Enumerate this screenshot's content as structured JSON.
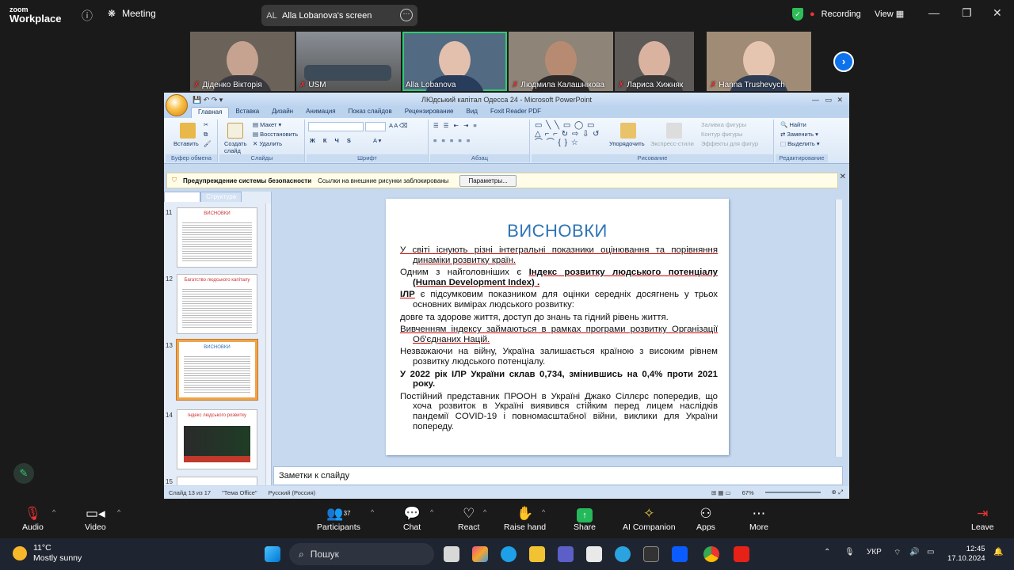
{
  "zoom": {
    "logo_line1": "zoom",
    "logo_line2": "Workplace",
    "meeting_label": "Meeting",
    "screen_avatar": "AL",
    "screen_label": "Alla Lobanova's screen",
    "recording_label": "Recording",
    "view_label": "View"
  },
  "participants": [
    {
      "name": "Діденко Вікторія",
      "muted": true
    },
    {
      "name": "USM",
      "muted": true
    },
    {
      "name": "Alla Lobanova",
      "muted": false,
      "active": true
    },
    {
      "name": "Людмила Калашнікова",
      "muted": true
    },
    {
      "name": "Лариса Хижняк",
      "muted": true
    },
    {
      "name": "Hanna Trushevych",
      "muted": true
    }
  ],
  "ppt": {
    "window_title": "ЛЮдський капітал Одесса 24 - Microsoft PowerPoint",
    "tabs": [
      "Главная",
      "Вставка",
      "Дизайн",
      "Анимация",
      "Показ слайдов",
      "Рецензирование",
      "Вид",
      "Foxit Reader PDF"
    ],
    "ribbon": {
      "paste": "Вставить",
      "new_slide": "Создать слайд",
      "layout": "Макет",
      "reset": "Восстановить",
      "delete": "Удалить",
      "arrange": "Упорядочить",
      "quick_styles": "Экспресс-стили",
      "shape_fill": "Заливка фигуры",
      "shape_outline": "Контур фигуры",
      "shape_effects": "Эффекты для фигур",
      "find": "Найти",
      "replace": "Заменить",
      "select": "Выделить",
      "groups": [
        "Буфер обмена",
        "Слайды",
        "Шрифт",
        "Абзац",
        "Рисование",
        "Редактирование"
      ]
    },
    "security": {
      "title": "Предупреждение системы безопасности",
      "message": "Ссылки на внешние рисунки заблокированы",
      "button": "Параметры..."
    },
    "pane_tabs": [
      "Слайды",
      "Структура"
    ],
    "thumbs": [
      {
        "num": "11",
        "title": "ВИСНОВКИ"
      },
      {
        "num": "12",
        "title": "Багатство людського капіталу"
      },
      {
        "num": "13",
        "title": "ВИСНОВКИ"
      },
      {
        "num": "14",
        "title": "Індекс людського розвитку"
      },
      {
        "num": "15",
        "title": ""
      }
    ],
    "slide": {
      "title": "ВИСНОВКИ",
      "p1": "У світі існують різні інтегральні показники оцінювання та порівняння динаміки розвитку країн.",
      "p2a": "Одним з найголовніших є ",
      "p2b": "Індекс розвитку людського потенціалу (Human Development Index) .",
      "p3a": "ІЛР",
      "p3b": " є підсумковим показником для оцінки середніх досягнень у трьох основних вимірах людського розвитку:",
      "p4": "довге та здорове життя, доступ до знань та гідний рівень життя.",
      "p5": "Вивченням індексу займаються в рамках програми розвитку Організації Об'єднаних Націй.",
      "p6": "Незважаючи на війну, Україна залишається країною з високим рівнем розвитку людського потенціалу.",
      "p7": "У 2022 рік ІЛР України склав 0,734, змінившись на 0,4% проти 2021 року.",
      "p8": "Постійний представник ПРООН в Україні Джако Сіллєрс попередив, що хоча розвиток в Україні виявився стійким перед лицем наслідків пандемії COVID-19 і повномасштабної війни, виклики для України попереду."
    },
    "notes": "Заметки к слайду",
    "status": {
      "slide": "Слайд 13 из 17",
      "theme": "\"Тема Office\"",
      "lang": "Русский (Россия)",
      "zoom": "67%"
    }
  },
  "controls": [
    {
      "label": "Audio",
      "icon": "mic-muted-icon"
    },
    {
      "label": "Video",
      "icon": "video-icon"
    },
    {
      "label": "Participants",
      "icon": "participants-icon",
      "count": "37"
    },
    {
      "label": "Chat",
      "icon": "chat-icon"
    },
    {
      "label": "React",
      "icon": "heart-icon"
    },
    {
      "label": "Raise hand",
      "icon": "hand-icon"
    },
    {
      "label": "Share",
      "icon": "share-icon"
    },
    {
      "label": "AI Companion",
      "icon": "sparkle-icon"
    },
    {
      "label": "Apps",
      "icon": "apps-icon"
    },
    {
      "label": "More",
      "icon": "more-icon"
    },
    {
      "label": "Leave",
      "icon": "leave-icon"
    }
  ],
  "taskbar": {
    "temp": "11°C",
    "weather": "Mostly sunny",
    "search": "Пошук",
    "lang": "УКР",
    "time": "12:45",
    "date": "17.10.2024"
  }
}
